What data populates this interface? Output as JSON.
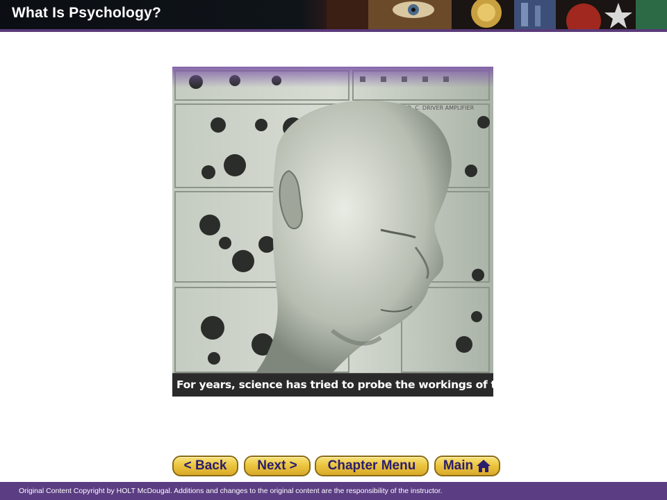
{
  "header": {
    "title": "What Is Psychology?"
  },
  "photo": {
    "caption": "For years, science has tried to probe the workings of the mind.",
    "description_icon": "photo-man-with-instruments"
  },
  "nav": {
    "back_label": "< Back",
    "next_label": "Next >",
    "chapter_menu_label": "Chapter Menu",
    "main_label": "Main",
    "main_icon": "home-icon",
    "button_color": "#ecc640",
    "text_color": "#2b1d6e"
  },
  "footer": {
    "copyright": "Original Content Copyright by HOLT McDougal. Additions and changes to the original content are the responsibility of the instructor.",
    "bg_color": "#5b3d83"
  }
}
